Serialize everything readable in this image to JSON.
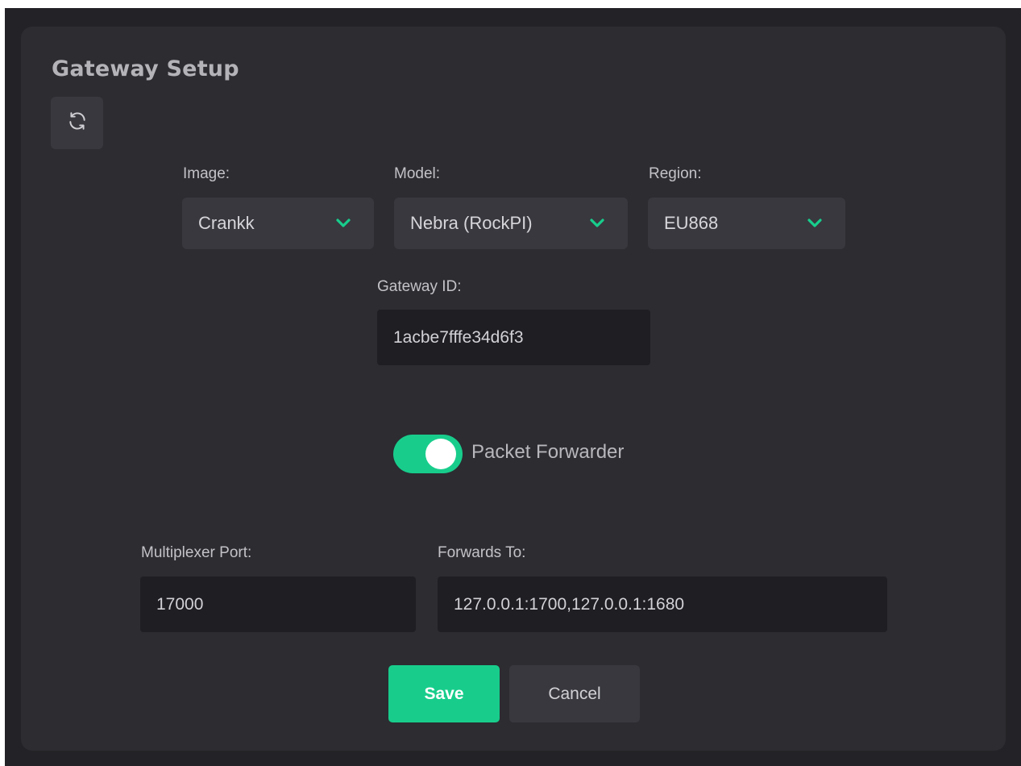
{
  "header": {
    "title": "Gateway Setup",
    "refresh_icon": "refresh-icon"
  },
  "selects": {
    "image": {
      "label": "Image:",
      "value": "Crankk"
    },
    "model": {
      "label": "Model:",
      "value": "Nebra (RockPI)"
    },
    "region": {
      "label": "Region:",
      "value": "EU868"
    }
  },
  "gateway_id": {
    "label": "Gateway ID:",
    "value": "1acbe7fffe34d6f3"
  },
  "packet_forwarder": {
    "label": "Packet Forwarder",
    "enabled": true
  },
  "multiplexer_port": {
    "label": "Multiplexer Port:",
    "value": "17000"
  },
  "forwards_to": {
    "label": "Forwards To:",
    "value": "127.0.0.1:1700,127.0.0.1:1680"
  },
  "actions": {
    "save_label": "Save",
    "cancel_label": "Cancel"
  },
  "colors": {
    "accent": "#18cd8c",
    "background": "#232327",
    "card": "#2c2c31",
    "control": "#38383e",
    "input": "#1f1f23"
  }
}
